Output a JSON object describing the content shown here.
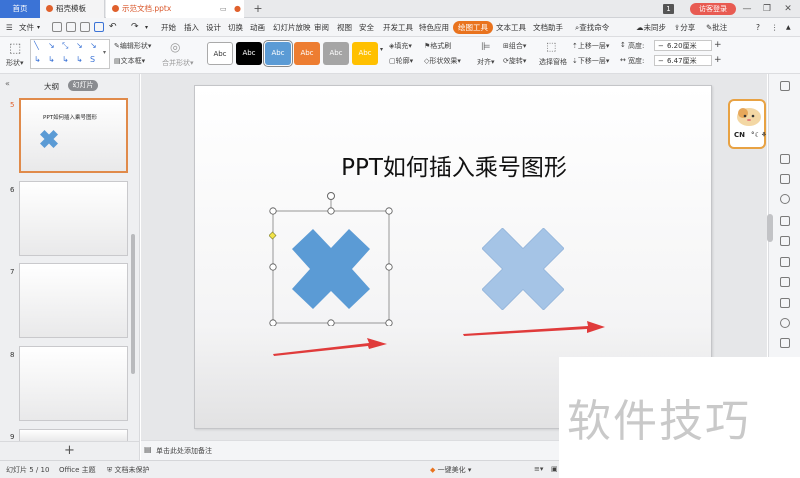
{
  "titlebar": {
    "tabs": [
      {
        "label": "首页"
      },
      {
        "label": "稻壳模板"
      },
      {
        "label": "示范文档.pptx"
      }
    ],
    "new_tab": "+",
    "page_badge": "1",
    "login_label": "访客登录",
    "minimize": "—",
    "restore": "❐",
    "close": "✕"
  },
  "menubar": {
    "file_label": "文件",
    "items": [
      "开始",
      "插入",
      "设计",
      "切换",
      "动画",
      "幻灯片放映",
      "审阅",
      "视图",
      "安全",
      "开发工具",
      "特色应用",
      "绘图工具",
      "文本工具",
      "文档助手"
    ],
    "search_label": "查找命令",
    "sync_label": "未同步",
    "share_label": "分享",
    "comment_label": "批注"
  },
  "ribbon": {
    "shape_label": "形状",
    "edit_shape": "编辑形状",
    "text_box": "文本框",
    "merge_shape": "合并形状",
    "styles": [
      "Abc",
      "Abc",
      "Abc",
      "Abc",
      "Abc",
      "Abc"
    ],
    "fill": "填充",
    "format_painter": "格式刷",
    "outline": "轮廓",
    "shape_effects": "形状效果",
    "align": "对齐",
    "group": "组合",
    "rotate": "旋转",
    "select_pane": "选择窗格",
    "bring_forward": "上移一层",
    "send_backward": "下移一层",
    "height_label": "高度:",
    "height_value": "6.20厘米",
    "width_label": "宽度:",
    "width_value": "6.47厘米"
  },
  "leftpanel": {
    "tab_outline": "大纲",
    "tab_slides": "幻灯片",
    "slide_numbers": [
      "5",
      "6",
      "7",
      "8",
      "9"
    ],
    "thumb_title": "PPT如何插入乘号图形",
    "add_slide": "+"
  },
  "slide": {
    "title": "PPT如何插入乘号图形"
  },
  "notes": {
    "placeholder": "单击此处添加备注"
  },
  "status": {
    "slide_info": "幻灯片 5 / 10",
    "theme": "Office 主题",
    "protection": "文档未保护",
    "beautify": "一键美化"
  },
  "mascot": {
    "label": "CN"
  },
  "watermark": {
    "text": "软件技巧"
  },
  "colors": {
    "accent_blue": "#3b73d6",
    "drawing_tools_orange": "#e9731e",
    "login_red": "#e85b52",
    "cross_selected": "#5b9bd5",
    "cross_light": "#a5c4e6",
    "arrow_red": "#e03b3b"
  }
}
